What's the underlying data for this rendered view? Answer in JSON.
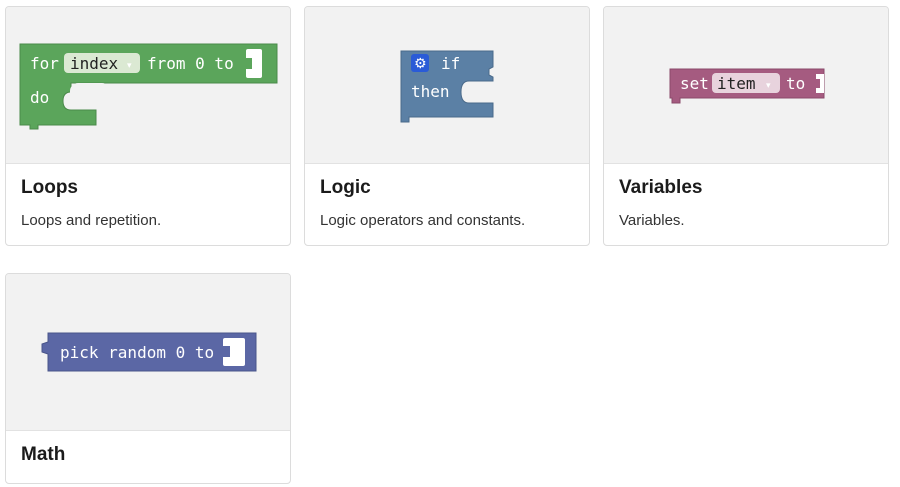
{
  "cards": [
    {
      "title": "Loops",
      "description": "Loops and repetition.",
      "color": "#5ba55b",
      "block": {
        "kw_for": "for",
        "dropdown_value": "index",
        "dropdown_arrow": "▾",
        "kw_from": "from 0 to",
        "kw_do": "do"
      }
    },
    {
      "title": "Logic",
      "description": "Logic operators and constants.",
      "color": "#5b80a5",
      "block": {
        "kw_if": "if",
        "kw_then": "then"
      }
    },
    {
      "title": "Variables",
      "description": "Variables.",
      "color": "#a55b80",
      "block": {
        "kw_set": "set",
        "dropdown_value": "item",
        "dropdown_arrow": "▾",
        "kw_to": "to"
      }
    },
    {
      "title": "Math",
      "description": "",
      "color": "#5b67a5",
      "block": {
        "label": "pick random 0 to"
      }
    }
  ]
}
